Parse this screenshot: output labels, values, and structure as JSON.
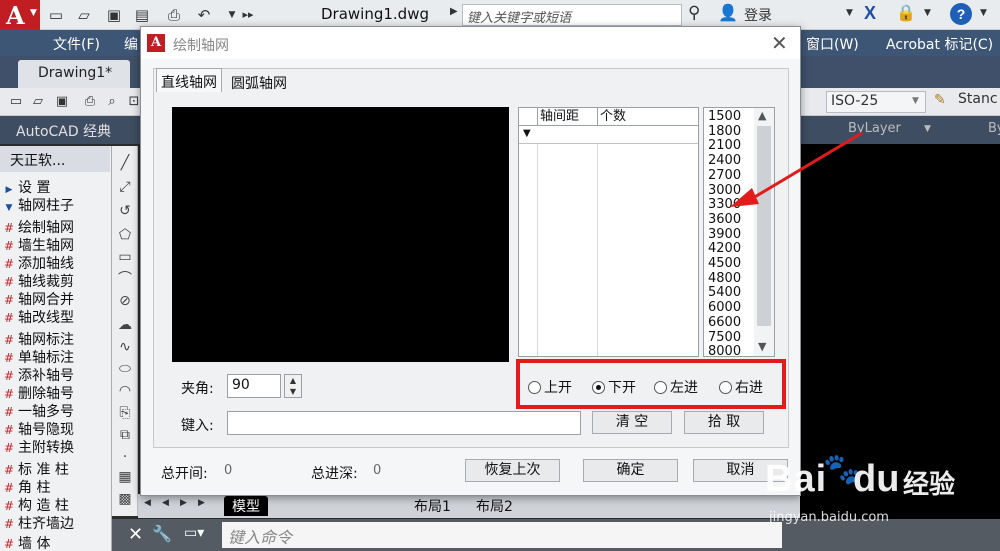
{
  "titlebar": {
    "doc_title": "Drawing1.dwg",
    "search_placeholder": "键入关键字或短语",
    "login": "登录"
  },
  "menubar": {
    "items": [
      "文件(F)",
      "编",
      "窗口(W)",
      "Acrobat 标记(C)"
    ]
  },
  "doctabs": {
    "active": "Drawing1*"
  },
  "toolbar": {
    "workspace": "AutoCAD 经典",
    "dim_style": "ISO-25",
    "text_style": "Stanc",
    "layer": "ByLayer",
    "by2": "By"
  },
  "tzpanel": {
    "title": "天正软...",
    "items": [
      {
        "label": "设    置",
        "icon": "triangle-right-icon"
      },
      {
        "label": "轴网柱子",
        "icon": "triangle-down-icon"
      },
      {
        "label": "绘制轴网",
        "icon": "grid-icon"
      },
      {
        "label": "墙生轴网",
        "icon": "wall-grid-icon"
      },
      {
        "label": "添加轴线",
        "icon": "add-axis-icon"
      },
      {
        "label": "轴线裁剪",
        "icon": "trim-axis-icon"
      },
      {
        "label": "轴网合并",
        "icon": "merge-grid-icon"
      },
      {
        "label": "轴改线型",
        "icon": "linetype-icon"
      },
      {
        "label": "轴网标注",
        "icon": "dim-grid-icon"
      },
      {
        "label": "单轴标注",
        "icon": "single-dim-icon"
      },
      {
        "label": "添补轴号",
        "icon": "add-number-icon"
      },
      {
        "label": "删除轴号",
        "icon": "delete-number-icon"
      },
      {
        "label": "一轴多号",
        "icon": "multi-number-icon"
      },
      {
        "label": "轴号隐现",
        "icon": "hide-number-icon"
      },
      {
        "label": "主附转换",
        "icon": "convert-icon"
      },
      {
        "label": "标 准 柱",
        "icon": "column-icon"
      },
      {
        "label": "角    柱",
        "icon": "corner-column-icon"
      },
      {
        "label": "构 造 柱",
        "icon": "construct-column-icon"
      },
      {
        "label": "柱齐墙边",
        "icon": "align-column-icon"
      },
      {
        "label": "墙    体",
        "icon": "wall-icon"
      }
    ]
  },
  "layout": {
    "tabs": [
      "模型",
      "布局1",
      "布局2"
    ]
  },
  "cmd": {
    "placeholder": "键入命令"
  },
  "dialog": {
    "title": "绘制轴网",
    "tabs": [
      "直线轴网",
      "圆弧轴网"
    ],
    "table_headers": [
      "轴间距",
      "个数"
    ],
    "values": [
      "1500",
      "1800",
      "2100",
      "2400",
      "2700",
      "3000",
      "3300",
      "3600",
      "3900",
      "4200",
      "4500",
      "4800",
      "5400",
      "6000",
      "6600",
      "7500",
      "8000"
    ],
    "angle_label": "夹角:",
    "angle_value": "90",
    "radios": [
      {
        "label": "上开",
        "checked": false
      },
      {
        "label": "下开",
        "checked": true
      },
      {
        "label": "左进",
        "checked": false
      },
      {
        "label": "右进",
        "checked": false
      }
    ],
    "input_label": "键入:",
    "clear_label": "清  空",
    "pick_label": "拾  取",
    "total_open_label": "总开间:",
    "total_open_value": "0",
    "total_depth_label": "总进深:",
    "total_depth_value": "0",
    "restore_label": "恢复上次",
    "ok_label": "确定",
    "cancel_label": "取消"
  },
  "watermark": {
    "bai": "Bai",
    "du": "du",
    "jy": "经验",
    "url": "jingyan.baidu.com"
  },
  "colors": {
    "annotation_red": "#e21b1b",
    "menubar": "#3d5675",
    "logo_red": "#c01e22"
  }
}
